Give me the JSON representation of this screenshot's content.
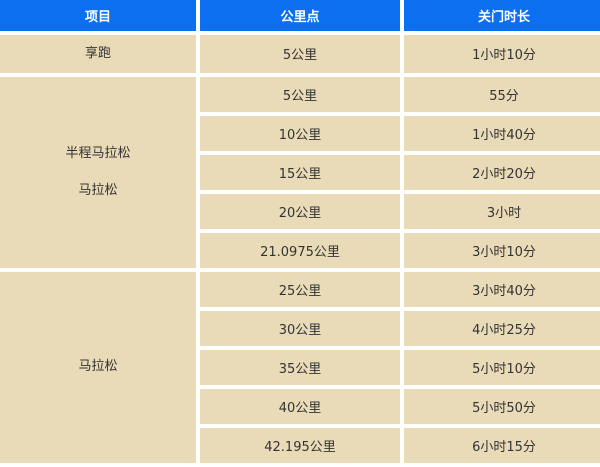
{
  "headers": [
    "项目",
    "公里点",
    "关门时长"
  ],
  "sections": [
    {
      "label_lines": [
        "享跑"
      ],
      "rows": [
        {
          "km": "5公里",
          "time": "1小时10分"
        }
      ]
    },
    {
      "label_lines": [
        "半程马拉松",
        "马拉松"
      ],
      "rows": [
        {
          "km": "5公里",
          "time": "55分"
        },
        {
          "km": "10公里",
          "time": "1小时40分"
        },
        {
          "km": "15公里",
          "time": "2小时20分"
        },
        {
          "km": "20公里",
          "time": "3小时"
        },
        {
          "km": "21.0975公里",
          "time": "3小时10分"
        }
      ]
    },
    {
      "label_lines": [
        "马拉松"
      ],
      "rows": [
        {
          "km": "25公里",
          "time": "3小时40分"
        },
        {
          "km": "30公里",
          "time": "4小时25分"
        },
        {
          "km": "35公里",
          "time": "5小时10分"
        },
        {
          "km": "40公里",
          "time": "5小时50分"
        },
        {
          "km": "42.195公里",
          "time": "6小时15分"
        }
      ]
    }
  ]
}
